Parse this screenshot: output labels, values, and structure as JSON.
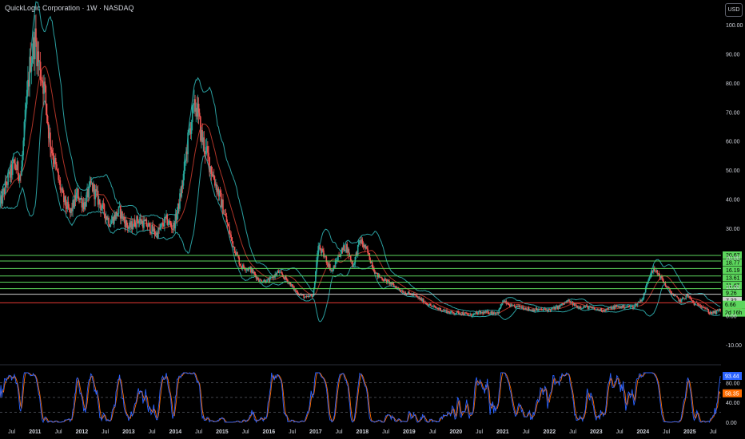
{
  "header": {
    "title": "QuickLogic Corporation · 1W · NASDAQ",
    "currency_label": "USD"
  },
  "colors": {
    "background": "#000000",
    "candle_up": "#26a69a",
    "candle_down": "#ef5350",
    "band": "#2a9fa0",
    "basis": "#c0392b",
    "hline_green": "#5cd65c",
    "hline_white": "#d0d0d0",
    "hline_red": "#e53935",
    "stoch_k": "#2962ff",
    "stoch_d": "#ff6d00",
    "axis_text": "#d1d4dc"
  },
  "chart_data": [
    {
      "type": "candlestick",
      "title": "QuickLogic Corporation · 1W · NASDAQ",
      "currency": "USD",
      "y_ticks": [
        "100.00",
        "90.00",
        "80.00",
        "70.00",
        "60.00",
        "50.00",
        "40.00",
        "30.00",
        "20.00",
        "10.00",
        "0.00",
        "-10.00"
      ],
      "ylim": [
        -15,
        103
      ],
      "x_ticks": [
        "Jul",
        "2011",
        "Jul",
        "2012",
        "Jul",
        "2013",
        "Jul",
        "2014",
        "Jul",
        "2015",
        "Jul",
        "2016",
        "Jul",
        "2017",
        "Jul",
        "2018",
        "Jul",
        "2019",
        "Jul",
        "2020",
        "Jul",
        "2021",
        "Jul",
        "2022",
        "Jul",
        "2023",
        "Jul",
        "2024",
        "Jul",
        "2025",
        "Jul"
      ],
      "xlim": [
        2010.25,
        2025.67
      ],
      "price_series": {
        "x": [
          2010.25,
          2010.4,
          2010.55,
          2010.7,
          2010.8,
          2010.9,
          2011.0,
          2011.1,
          2011.2,
          2011.3,
          2011.45,
          2011.6,
          2011.75,
          2011.9,
          2012.05,
          2012.2,
          2012.4,
          2012.6,
          2012.8,
          2013.0,
          2013.2,
          2013.4,
          2013.6,
          2013.8,
          2013.95,
          2014.05,
          2014.15,
          2014.25,
          2014.35,
          2014.45,
          2014.55,
          2014.7,
          2014.85,
          2015.0,
          2015.2,
          2015.4,
          2015.6,
          2015.8,
          2016.0,
          2016.2,
          2016.4,
          2016.6,
          2016.8,
          2016.95,
          2017.05,
          2017.2,
          2017.35,
          2017.5,
          2017.65,
          2017.8,
          2017.95,
          2018.1,
          2018.3,
          2018.5,
          2018.7,
          2018.9,
          2019.1,
          2019.3,
          2019.5,
          2019.7,
          2019.9,
          2020.1,
          2020.3,
          2020.5,
          2020.7,
          2020.9,
          2021.0,
          2021.2,
          2021.4,
          2021.6,
          2021.8,
          2022.0,
          2022.2,
          2022.4,
          2022.6,
          2022.8,
          2023.0,
          2023.2,
          2023.4,
          2023.6,
          2023.8,
          2024.0,
          2024.1,
          2024.2,
          2024.35,
          2024.5,
          2024.65,
          2024.8,
          2024.95,
          2025.1,
          2025.2,
          2025.3,
          2025.42,
          2025.55,
          2025.65
        ],
        "y": [
          38,
          46,
          52,
          48,
          70,
          88,
          95,
          85,
          78,
          62,
          50,
          40,
          35,
          42,
          38,
          45,
          38,
          32,
          36,
          30,
          33,
          31,
          28,
          33,
          30,
          36,
          45,
          58,
          68,
          73,
          62,
          54,
          46,
          38,
          26,
          17,
          16,
          12,
          12,
          15,
          12,
          8,
          6,
          7,
          24,
          20,
          15,
          21,
          24,
          17,
          26,
          22,
          14,
          12,
          10,
          8,
          7,
          5,
          3,
          2,
          1,
          1,
          0,
          1,
          1,
          1,
          5,
          3,
          3,
          2,
          2,
          2,
          3,
          5,
          3,
          3,
          2,
          2,
          3,
          3,
          3,
          6,
          12,
          16,
          14,
          10,
          7,
          5,
          7,
          4,
          4,
          3,
          1,
          1,
          2
        ]
      },
      "horizontal_levels": [
        {
          "value": 20.67,
          "label": "20.67",
          "color": "green"
        },
        {
          "value": 18.77,
          "label": "18.77",
          "color": "green"
        },
        {
          "value": 16.19,
          "label": "16.19",
          "color": "green"
        },
        {
          "value": 13.61,
          "label": "13.61",
          "color": "green"
        },
        {
          "value": 11.47,
          "label": "11.47",
          "color": "green"
        },
        {
          "value": 9.26,
          "label": "9.26",
          "color": "green"
        },
        {
          "value": 7.32,
          "label": "7.32",
          "color": "white"
        },
        {
          "value": 4.37,
          "label": "4.37",
          "color": "red"
        }
      ],
      "price_tags": [
        {
          "label": "6.66",
          "color": "green"
        },
        {
          "label": "2d 16h",
          "color": "green"
        }
      ],
      "last_value_label": "-4.37"
    },
    {
      "type": "line",
      "title": "",
      "y_ticks": [
        "80.00",
        "40.00",
        "0.00"
      ],
      "ylim": [
        -5,
        108
      ],
      "reference_lines": [
        80,
        50,
        20
      ],
      "series": [
        {
          "key": "k",
          "last_value": 93.44,
          "last_label": "93.44"
        },
        {
          "key": "d",
          "last_value": 58.35,
          "last_label": "58.35"
        }
      ]
    }
  ]
}
